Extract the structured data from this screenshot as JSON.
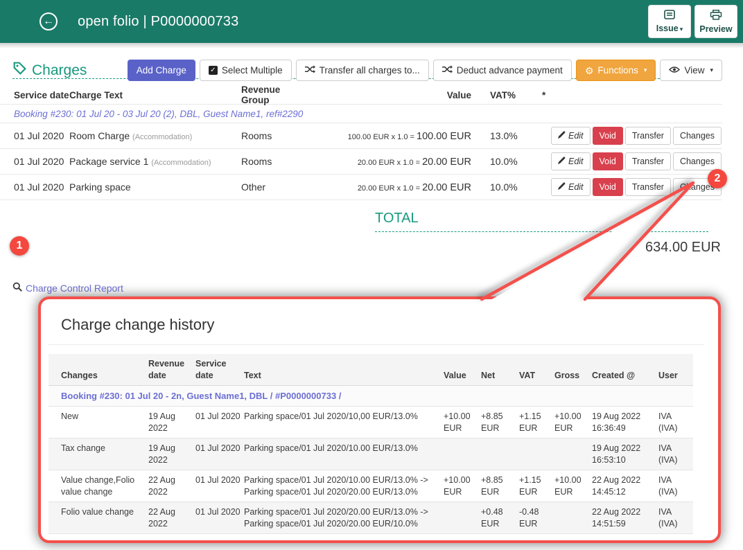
{
  "topbar": {
    "title": "open folio | P0000000733",
    "issue_label": "Issue",
    "preview_label": "Preview"
  },
  "toolbar": {
    "heading": "Charges",
    "add_charge": "Add Charge",
    "select_multiple": "Select Multiple",
    "transfer_all": "Transfer all charges to...",
    "deduct_advance": "Deduct advance payment",
    "functions": "Functions",
    "view": "View"
  },
  "icons": {
    "back": "←",
    "caret": "▾",
    "check": "✓",
    "gear": "⚙"
  },
  "charges_table": {
    "headers": {
      "service_date": "Service date",
      "charge_text": "Charge Text",
      "revenue_group": "Revenue Group",
      "value": "Value",
      "vat": "VAT%",
      "note": "*"
    },
    "booking_line": "Booking #230: 01 Jul 20 - 03 Jul 20 (2), DBL, Guest Name1, ref#2290",
    "rows": [
      {
        "service_date": "01 Jul 2020",
        "charge_text": "Room Charge",
        "charge_note": "(Accommodation)",
        "revenue_group": "Rooms",
        "value_calc": "100.00 EUR x 1.0 = ",
        "value_total": "100.00 EUR",
        "vat": "13.0%"
      },
      {
        "service_date": "01 Jul 2020",
        "charge_text": "Package service 1",
        "charge_note": "(Accommodation)",
        "revenue_group": "Rooms",
        "value_calc": "20.00 EUR x 1.0 = ",
        "value_total": "20.00 EUR",
        "vat": "10.0%"
      },
      {
        "service_date": "01 Jul 2020",
        "charge_text": "Parking space",
        "charge_note": "",
        "revenue_group": "Other",
        "value_calc": "20.00 EUR x 1.0 = ",
        "value_total": "20.00 EUR",
        "vat": "10.0%"
      }
    ],
    "actions": {
      "edit": "Edit",
      "void": "Void",
      "transfer": "Transfer",
      "changes": "Changes"
    }
  },
  "total": {
    "heading": "TOTAL",
    "amount": "634.00 EUR"
  },
  "report_link": {
    "label": "Charge Control Report"
  },
  "annotations": {
    "one": "1",
    "two": "2"
  },
  "popup": {
    "title": "Charge change history",
    "headers": [
      "Changes",
      "Revenue date",
      "Service date",
      "Text",
      "Value",
      "Net",
      "VAT",
      "Gross",
      "Created @",
      "User"
    ],
    "booking_line": "Booking #230: 01 Jul 20 - 2n, Guest Name1, DBL / #P0000000733 /",
    "rows": [
      {
        "changes": "New",
        "revenue_date": "19 Aug 2022",
        "service_date": "01 Jul 2020",
        "text1": "Parking space/01 Jul 2020/10,00 EUR/13.0%",
        "text2": "",
        "value": "+10.00 EUR",
        "net": "+8.85 EUR",
        "vat": "+1.15 EUR",
        "gross": "+10.00 EUR",
        "created": "19 Aug 2022 16:36:49",
        "user": "IVA (IVA)"
      },
      {
        "changes": "Tax change",
        "revenue_date": "19 Aug 2022",
        "service_date": "01 Jul 2020",
        "text1": "Parking space/01 Jul 2020/10.00 EUR/13.0%",
        "text2": "",
        "value": "",
        "net": "",
        "vat": "",
        "gross": "",
        "created": "19 Aug 2022 16:53:10",
        "user": "IVA (IVA)"
      },
      {
        "changes": "Value change,Folio value change",
        "revenue_date": "22 Aug 2022",
        "service_date": "01 Jul 2020",
        "text1": "Parking space/01 Jul 2020/10.00 EUR/13.0% ->",
        "text2": "Parking space/01 Jul 2020/20.00 EUR/13.0%",
        "value": "+10.00 EUR",
        "net": "+8.85 EUR",
        "vat": "+1.15 EUR",
        "gross": "+10.00 EUR",
        "created": "22 Aug 2022 14:45:12",
        "user": "IVA (IVA)"
      },
      {
        "changes": "Folio value change",
        "revenue_date": "22 Aug 2022",
        "service_date": "01 Jul 2020",
        "text1": "Parking space/01 Jul 2020/20.00 EUR/13.0% ->",
        "text2": "Parking space/01 Jul 2020/20.00 EUR/10.0%",
        "value": "",
        "net": "+0.48 EUR",
        "vat": "-0.48 EUR",
        "gross": "",
        "created": "22 Aug 2022 14:51:59",
        "user": "IVA (IVA)"
      }
    ]
  },
  "colors": {
    "header_teal": "#1a7a68",
    "accent_teal": "#16997e",
    "add_charge_indigo": "#5a62c8",
    "functions_orange": "#f0a53e",
    "void_red": "#d9404d",
    "annotation_red": "#f4483f",
    "link_violet": "#6c6fd4"
  }
}
